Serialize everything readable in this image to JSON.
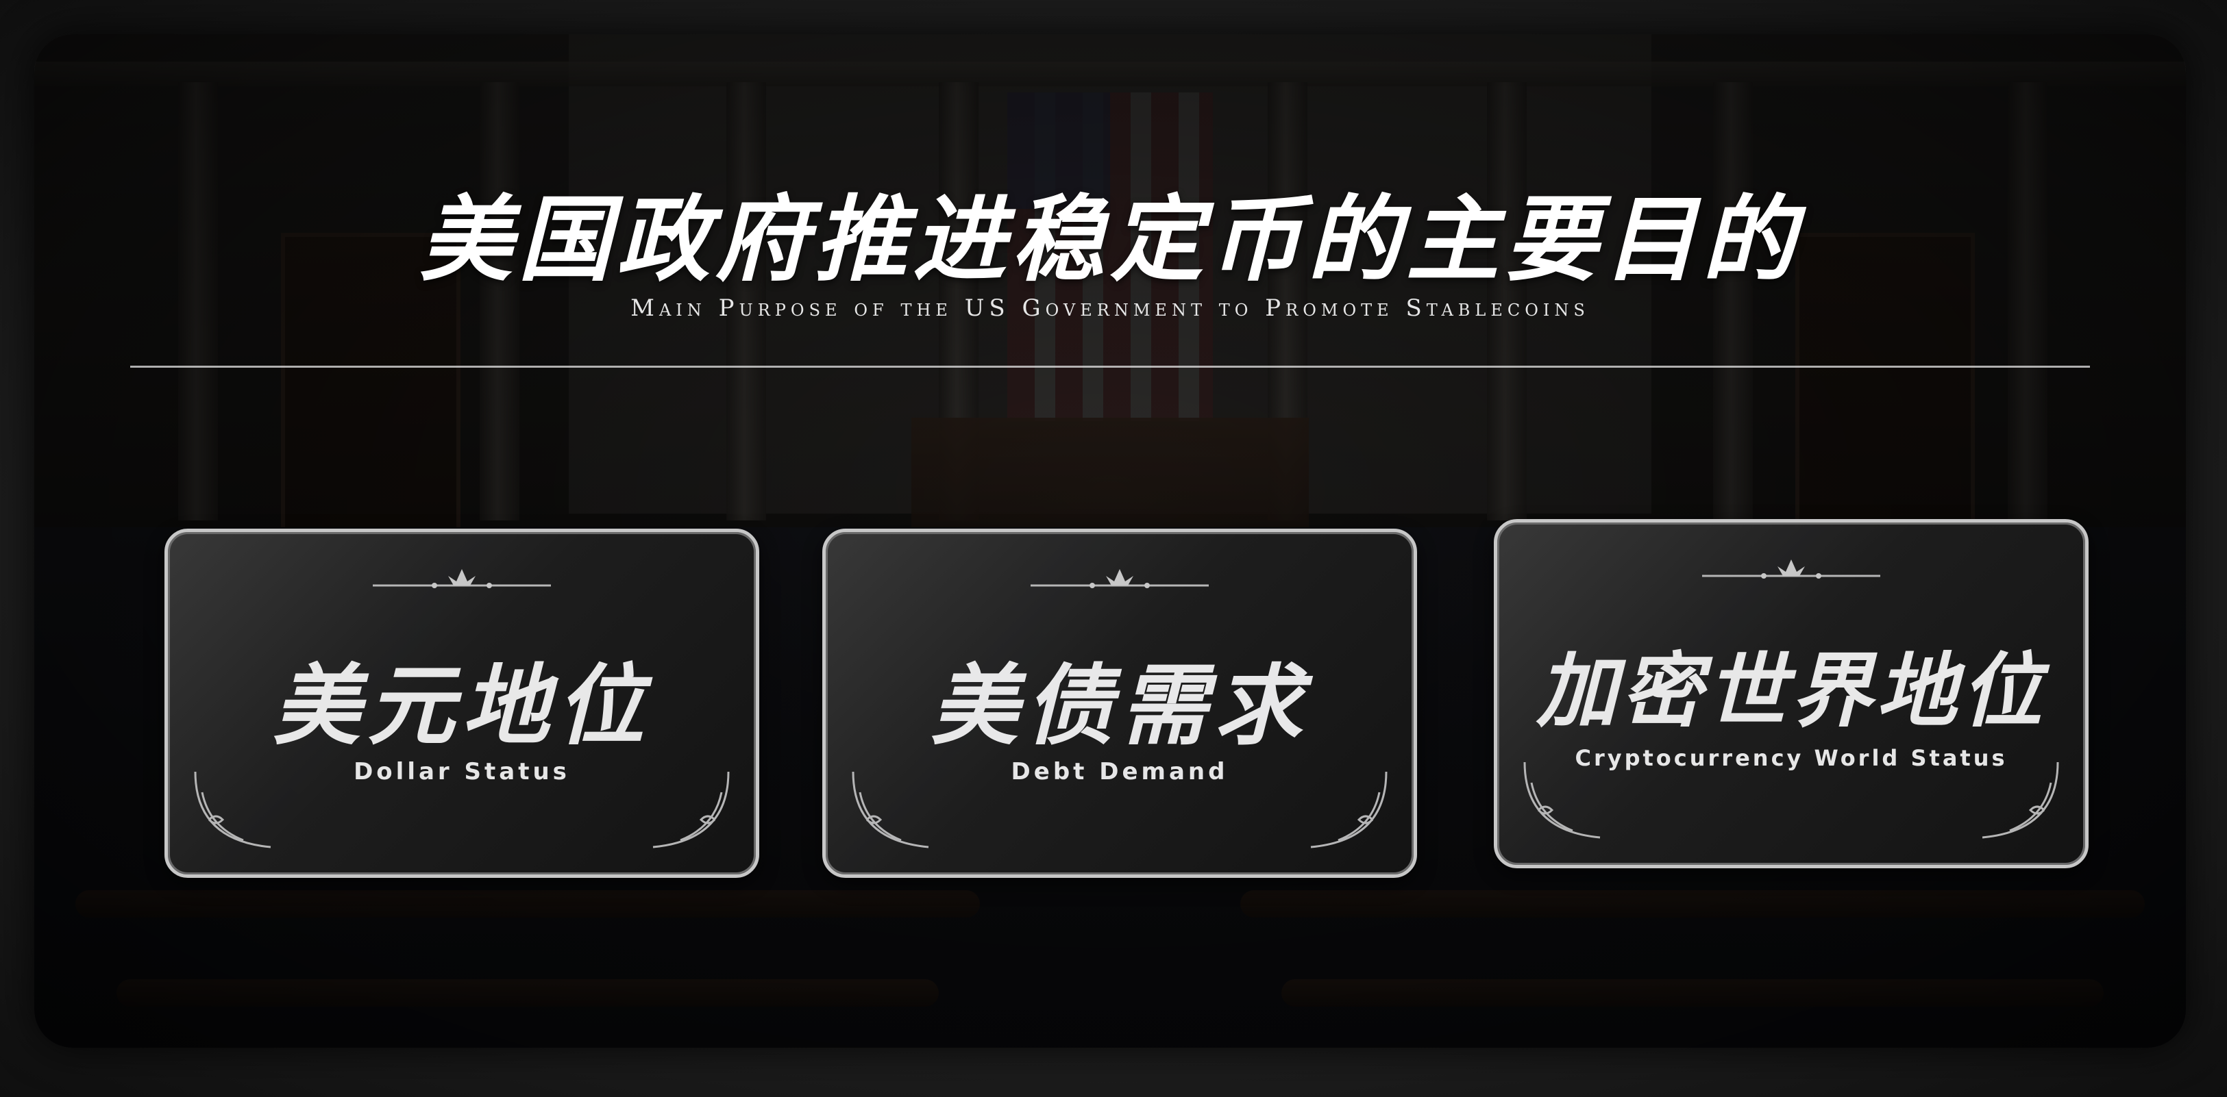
{
  "title": {
    "main": "美国政府推进稳定币的主要目的",
    "subtitle": "Main Purpose of the US Government to Promote Stablecoins"
  },
  "cards": [
    {
      "title": "美元地位",
      "subtitle": "Dollar Status"
    },
    {
      "title": "美债需求",
      "subtitle": "Debt Demand"
    },
    {
      "title": "加密世界地位",
      "subtitle": "Cryptocurrency World Status"
    }
  ],
  "colors": {
    "text": "#ffffff",
    "card_border": "#cfcfcf",
    "card_bg": "#1e1e1e"
  }
}
